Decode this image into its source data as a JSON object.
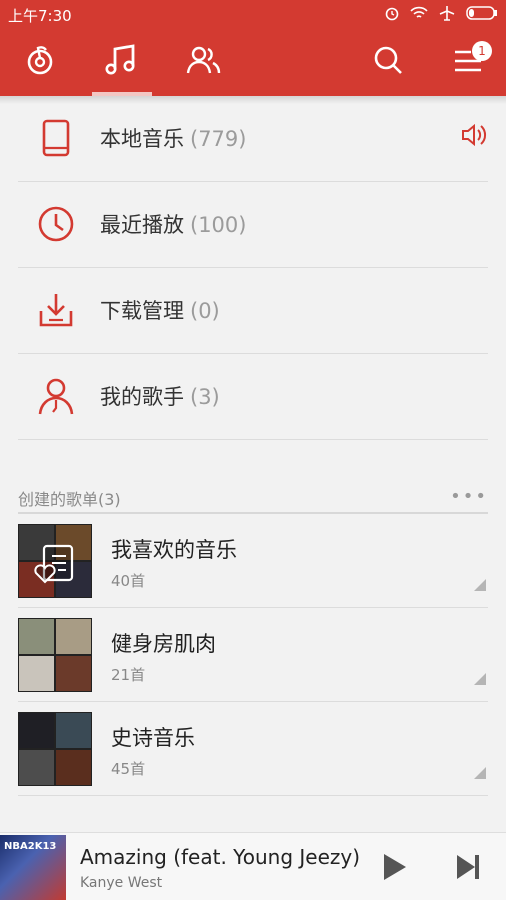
{
  "status": {
    "time": "上午7:30"
  },
  "header": {
    "badge": "1",
    "icons": [
      "netease-logo-icon",
      "music-note-icon",
      "friends-icon",
      "search-icon",
      "menu-icon"
    ]
  },
  "library": [
    {
      "label": "本地音乐",
      "count": "(779)",
      "icon": "phone-icon",
      "playing": true
    },
    {
      "label": "最近播放",
      "count": "(100)",
      "icon": "clock-icon"
    },
    {
      "label": "下载管理",
      "count": "(0)",
      "icon": "download-icon"
    },
    {
      "label": "我的歌手",
      "count": "(3)",
      "icon": "artist-icon"
    }
  ],
  "playlists_section": {
    "title": "创建的歌单(3)",
    "more": "•••"
  },
  "playlists": [
    {
      "name": "我喜欢的音乐",
      "count": "40首"
    },
    {
      "name": "健身房肌肉",
      "count": "21首"
    },
    {
      "name": "史诗音乐",
      "count": "45首"
    }
  ],
  "player": {
    "song": "Amazing (feat. Young Jeezy)",
    "artist": "Kanye West",
    "art_text": "NBA2K13"
  },
  "colors": {
    "accent": "#d33a31"
  }
}
